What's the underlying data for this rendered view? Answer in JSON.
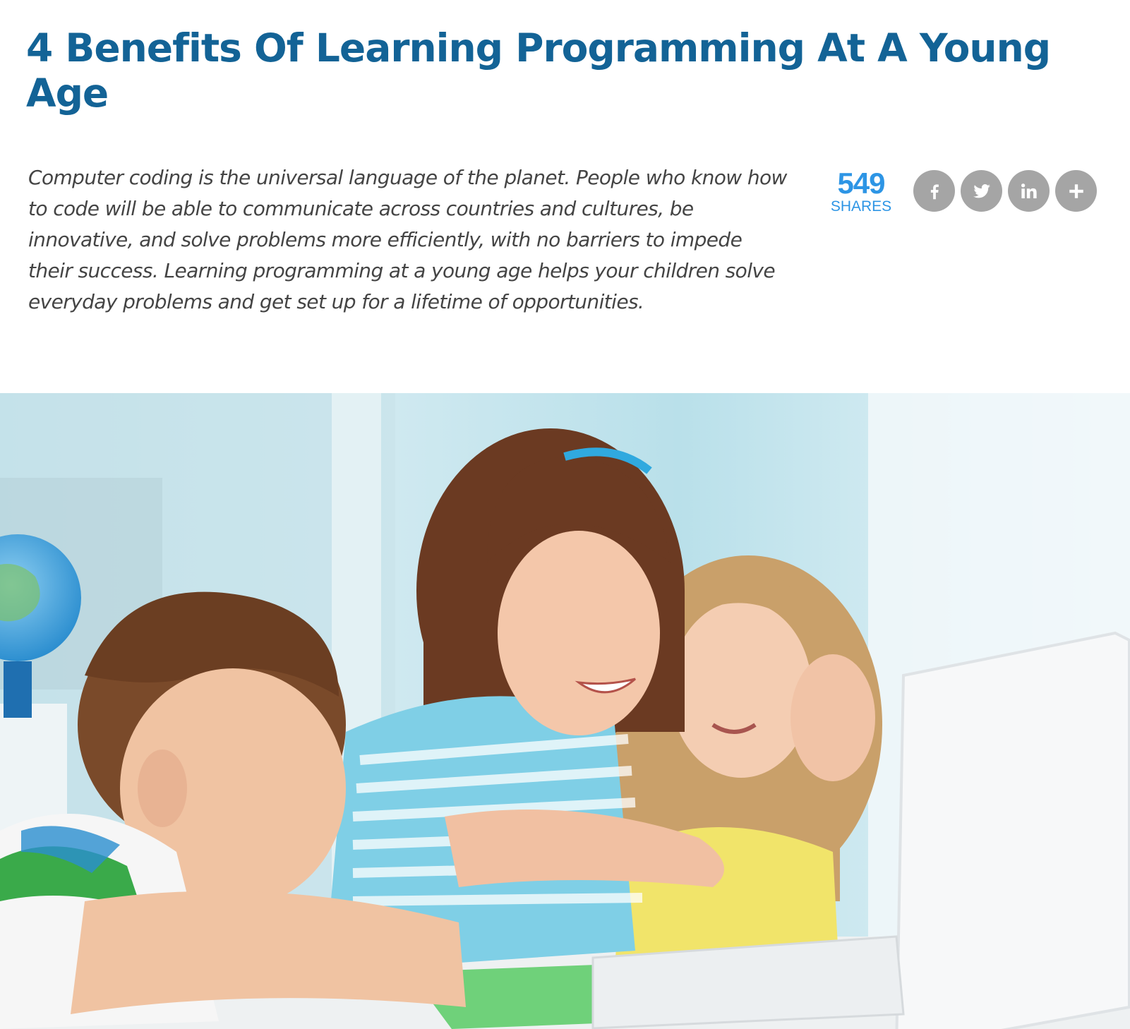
{
  "article": {
    "title": "4 Benefits Of Learning Programming At A Young Age",
    "intro": "Computer coding is the universal language of the planet. People who know how to code will be able to communicate across countries and cultures, be innovative, and solve problems more efficiently, with no barriers to impede their success. Learning programming at a young age helps your children solve everyday problems and get set up for a lifetime of opportunities."
  },
  "share": {
    "count": "549",
    "label": "SHARES",
    "buttons": [
      {
        "icon": "facebook-icon"
      },
      {
        "icon": "twitter-icon"
      },
      {
        "icon": "linkedin-icon"
      },
      {
        "icon": "plus-icon"
      }
    ]
  },
  "colors": {
    "title": "#136396",
    "shares": "#2d95e5",
    "share_button": "#a5a5a5",
    "body_text": "#444444"
  }
}
